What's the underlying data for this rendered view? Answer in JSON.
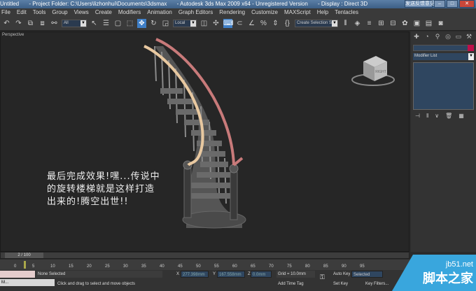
{
  "titlebar": {
    "doc": "Untitled",
    "folder": "- Project Folder: C:\\Users\\lizhonhui\\Documents\\3dsmax",
    "app": "- Autodesk 3ds Max  2009 x64  - Unregistered Version",
    "display": "- Display : Direct 3D",
    "extra": "发送反馈意见"
  },
  "menu": [
    "File",
    "Edit",
    "Tools",
    "Group",
    "Views",
    "Create",
    "Modifiers",
    "Animation",
    "Graph Editors",
    "Rendering",
    "Customize",
    "MAXScript",
    "Help",
    "Tentacles"
  ],
  "toolbar": {
    "filter": "All",
    "coord_system": "Local",
    "named_selection": "Create Selection Set"
  },
  "viewport": {
    "label": "Perspective",
    "caption_lines": [
      "最后完成效果!嘿...传说中",
      "的旋转楼梯就是这样打造",
      "出来的!腾空出世!!"
    ],
    "viewcube_label": "RIGHT"
  },
  "command_panel": {
    "modifier_list": "Modifier List",
    "object_color": "#c0104a"
  },
  "timeline": {
    "current": "2 / 100",
    "ticks": [
      "0",
      "5",
      "10",
      "15",
      "20",
      "25",
      "30",
      "35",
      "40",
      "45",
      "50",
      "55",
      "60",
      "65",
      "70",
      "75",
      "80",
      "85",
      "90",
      "95"
    ]
  },
  "status": {
    "selection": "None Selected",
    "prompt": "Click and drag to select and move objects",
    "x_label": "X",
    "y_label": "Y",
    "z_label": "Z",
    "x": "277.398mm",
    "y": "167.558mm",
    "z": "0.0mm",
    "grid": "Grid = 10.0mm",
    "auto_key": "Auto Key",
    "set_key": "Set Key",
    "key_mode": "Selected",
    "key_filters": "Key Filters...",
    "add_time_tag": "Add Time Tag",
    "taskbar_item": "M..."
  },
  "watermark": {
    "site": "jb51.net",
    "name": "脚本之家"
  }
}
